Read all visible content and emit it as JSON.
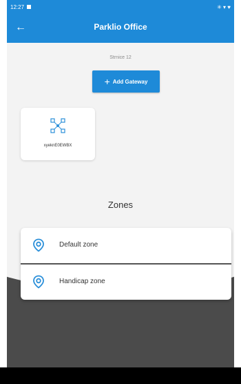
{
  "status_bar": {
    "time": "12:27",
    "right_text": "✳ ▾ ♥"
  },
  "header": {
    "title": "Parklio Office"
  },
  "location": {
    "subtitle": "Strnice 12"
  },
  "actions": {
    "add_gateway_label": "Add Gateway"
  },
  "gateways": [
    {
      "name": "xyeknE0EWBX"
    }
  ],
  "zones": {
    "title": "Zones",
    "items": [
      {
        "label": "Default zone"
      },
      {
        "label": "Handicap zone"
      }
    ]
  },
  "colors": {
    "primary": "#1e8ad8",
    "dark_background": "#4b4b4b"
  },
  "icons": {
    "back": "arrow-left-icon",
    "add": "plus-icon",
    "gateway": "network-nodes-icon",
    "zone": "location-pin-icon"
  }
}
